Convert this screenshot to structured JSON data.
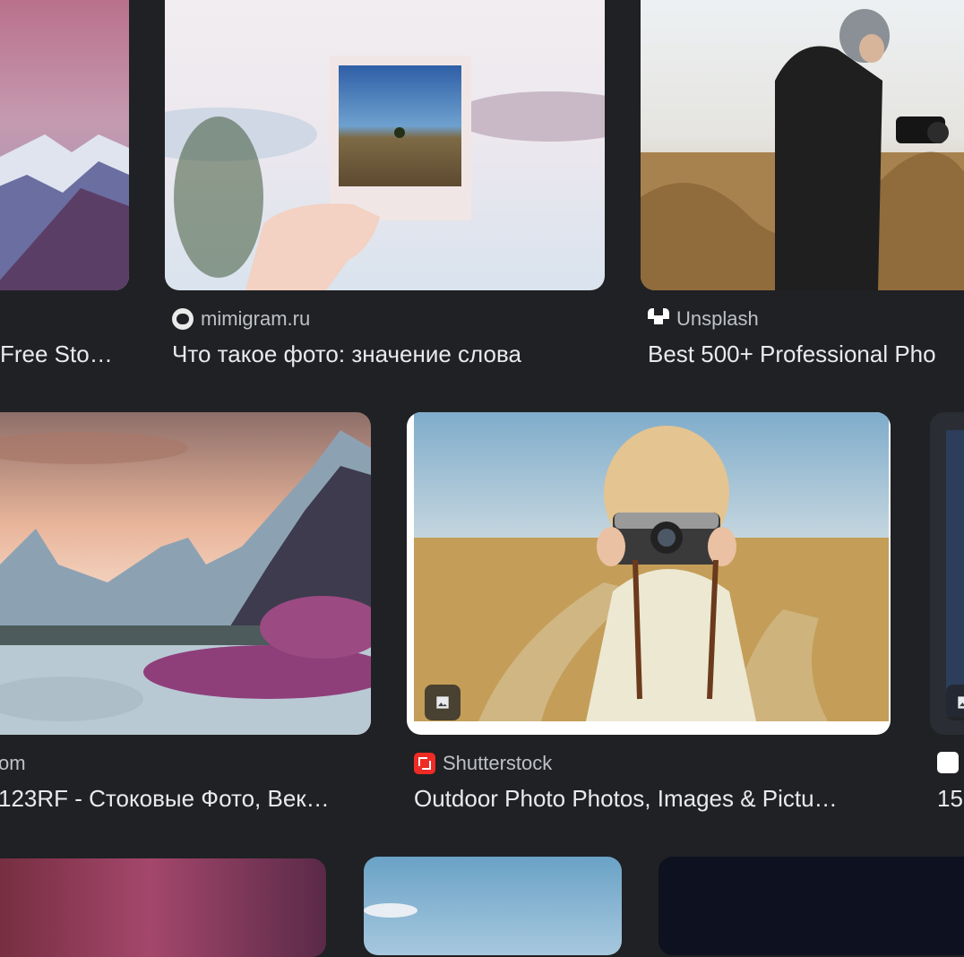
{
  "results": [
    {
      "source": "",
      "title": "Free Sto…"
    },
    {
      "source": "mimigram.ru",
      "title": "Что такое фото: значение слова"
    },
    {
      "source": "Unsplash",
      "title": "Best 500+ Professional Pho"
    },
    {
      "source": "om",
      "title": "123RF - Стоковые Фото, Век…"
    },
    {
      "source": "Shutterstock",
      "title": "Outdoor Photo Photos, Images & Pictu…",
      "badge": "image-icon"
    },
    {
      "source": "",
      "title": "15",
      "badge": "image-icon"
    }
  ],
  "colors": {
    "background": "#202124",
    "source_text": "#bdc1c6",
    "title_text": "#e8eaed",
    "shutterstock_brand": "#ee2b24"
  }
}
